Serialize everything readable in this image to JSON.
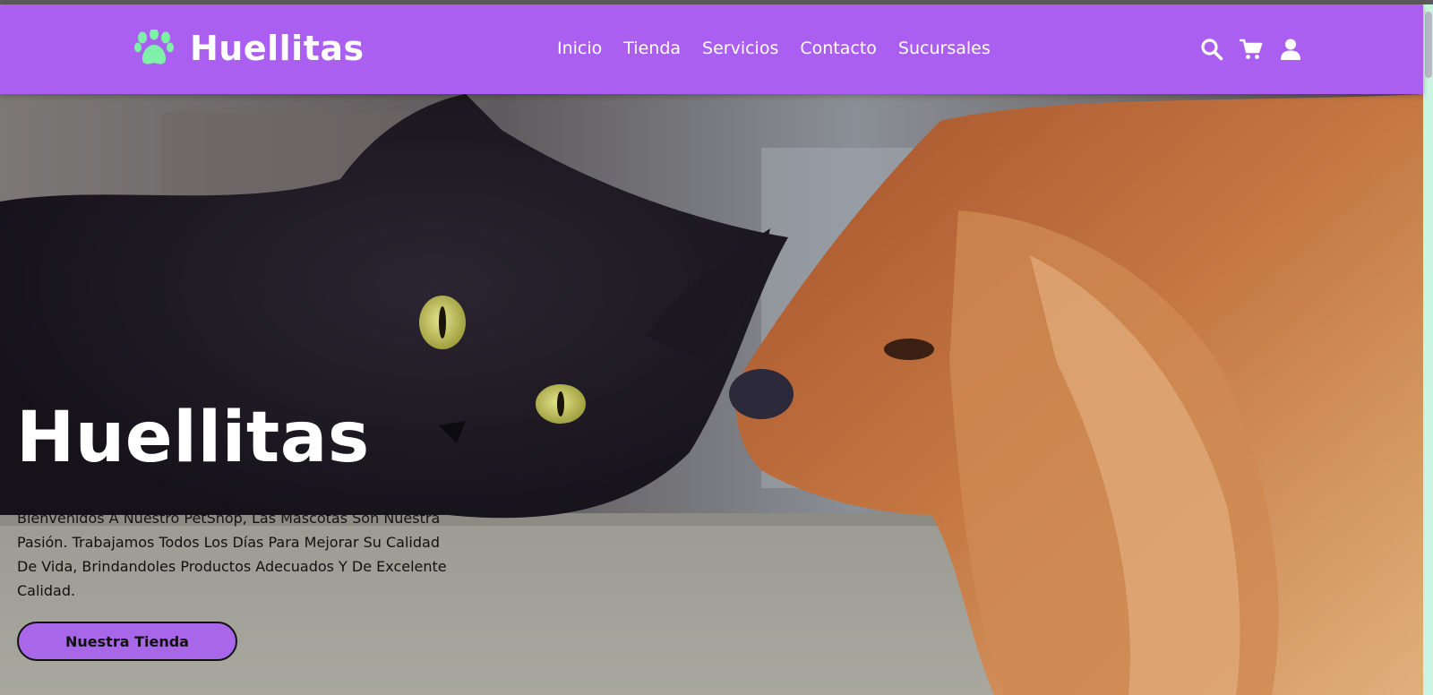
{
  "header": {
    "brand": "Huellitas",
    "logo_icon": "paw-icon",
    "nav": [
      {
        "label": "Inicio"
      },
      {
        "label": "Tienda"
      },
      {
        "label": "Servicios"
      },
      {
        "label": "Contacto"
      },
      {
        "label": "Sucursales"
      }
    ],
    "actions": [
      {
        "icon": "search-icon"
      },
      {
        "icon": "cart-icon"
      },
      {
        "icon": "user-icon"
      }
    ]
  },
  "hero": {
    "title": "Huellitas",
    "description": "Bienvenidos A Nuestro PetShop, Las Mascotas Son Nuestra Pasión. Trabajamos Todos Los Días Para Mejorar Su Calidad De Vida, Brindandoles Productos Adecuados Y De Excelente Calidad.",
    "button_label": "Nuestra Tienda",
    "image_subject": "black cat and brown spaniel dog lying face to face"
  },
  "colors": {
    "header_bg": "#ab5ff0",
    "paw": "#7ef0a8",
    "button_bg": "#a866e8",
    "text_dark": "#111111",
    "text_light": "#ffffff"
  }
}
